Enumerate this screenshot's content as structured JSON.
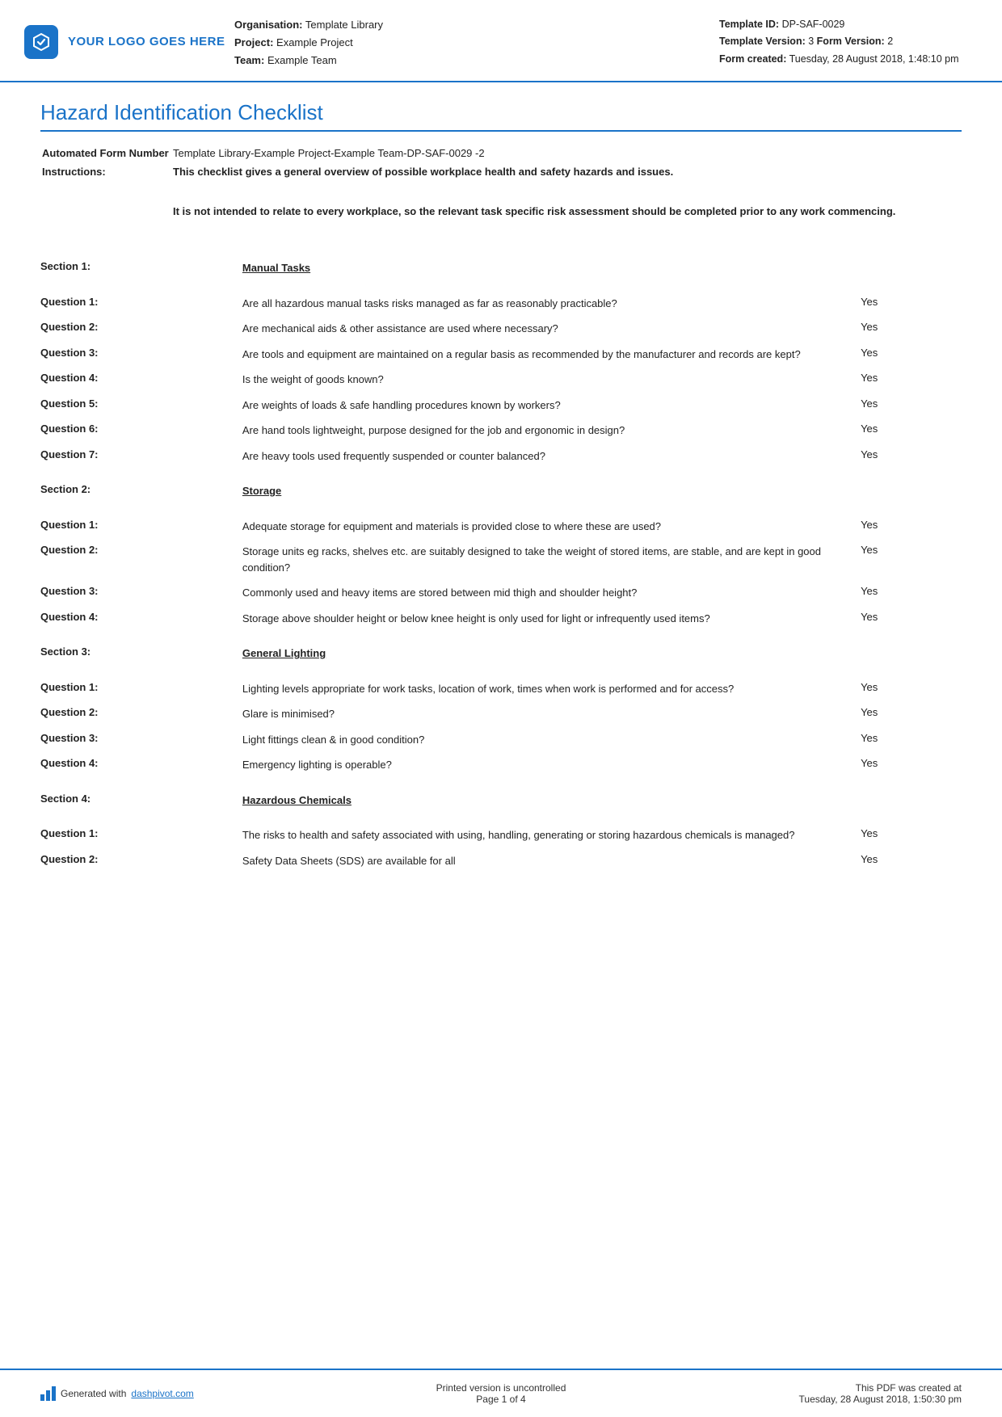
{
  "header": {
    "logo_text": "YOUR LOGO GOES HERE",
    "org_label": "Organisation:",
    "org_value": "Template Library",
    "project_label": "Project:",
    "project_value": "Example Project",
    "team_label": "Team:",
    "team_value": "Example Team",
    "template_id_label": "Template ID:",
    "template_id_value": "DP-SAF-0029",
    "template_version_label": "Template Version:",
    "template_version_value": "3",
    "form_version_label": "Form Version:",
    "form_version_value": "2",
    "form_created_label": "Form created:",
    "form_created_value": "Tuesday, 28 August 2018, 1:48:10 pm"
  },
  "page_title": "Hazard Identification Checklist",
  "meta": {
    "form_number_label": "Automated Form Number",
    "form_number_value": "Template Library-Example Project-Example Team-DP-SAF-0029  -2",
    "instructions_label": "Instructions:",
    "instructions_bold": "This checklist gives a general overview of possible workplace health and safety hazards and issues.",
    "instructions_text": "It is not intended to relate to every workplace, so the relevant task specific risk assessment should be completed prior to any work commencing."
  },
  "sections": [
    {
      "label": "Section 1:",
      "title": "Manual Tasks",
      "questions": [
        {
          "label": "Question 1:",
          "text": "Are all hazardous manual tasks risks managed as far as reasonably practicable?",
          "answer": "Yes"
        },
        {
          "label": "Question 2:",
          "text": "Are mechanical aids & other assistance are used where necessary?",
          "answer": "Yes"
        },
        {
          "label": "Question 3:",
          "text": "Are tools and equipment are maintained on a regular basis as recommended by the manufacturer and records are kept?",
          "answer": "Yes"
        },
        {
          "label": "Question 4:",
          "text": "Is the weight of goods known?",
          "answer": "Yes"
        },
        {
          "label": "Question 5:",
          "text": "Are weights of loads & safe handling procedures known by workers?",
          "answer": "Yes"
        },
        {
          "label": "Question 6:",
          "text": "Are hand tools lightweight, purpose designed for the job and ergonomic in design?",
          "answer": "Yes"
        },
        {
          "label": "Question 7:",
          "text": "Are heavy tools used frequently suspended or counter balanced?",
          "answer": "Yes"
        }
      ]
    },
    {
      "label": "Section 2:",
      "title": "Storage",
      "questions": [
        {
          "label": "Question 1:",
          "text": "Adequate storage for equipment and materials is provided close to where these are used?",
          "answer": "Yes"
        },
        {
          "label": "Question 2:",
          "text": "Storage units eg racks, shelves etc. are suitably designed to take the weight of stored items, are stable, and are kept in good condition?",
          "answer": "Yes"
        },
        {
          "label": "Question 3:",
          "text": "Commonly used and heavy items are stored between mid thigh and shoulder height?",
          "answer": "Yes"
        },
        {
          "label": "Question 4:",
          "text": "Storage above shoulder height or below knee height is only used for light or infrequently used items?",
          "answer": "Yes"
        }
      ]
    },
    {
      "label": "Section 3:",
      "title": "General Lighting",
      "questions": [
        {
          "label": "Question 1:",
          "text": "Lighting levels appropriate for work tasks, location of work, times when work is performed and for access?",
          "answer": "Yes"
        },
        {
          "label": "Question 2:",
          "text": "Glare is minimised?",
          "answer": "Yes"
        },
        {
          "label": "Question 3:",
          "text": "Light fittings clean & in good condition?",
          "answer": "Yes"
        },
        {
          "label": "Question 4:",
          "text": "Emergency lighting is operable?",
          "answer": "Yes"
        }
      ]
    },
    {
      "label": "Section 4:",
      "title": "Hazardous Chemicals",
      "questions": [
        {
          "label": "Question 1:",
          "text": "The risks to health and safety associated with using, handling, generating or storing hazardous chemicals is managed?",
          "answer": "Yes"
        },
        {
          "label": "Question 2:",
          "text": "Safety Data Sheets (SDS) are available for all",
          "answer": "Yes"
        }
      ]
    }
  ],
  "footer": {
    "generated_text": "Generated with ",
    "generated_link": "dashpivot.com",
    "center_line1": "Printed version is uncontrolled",
    "center_line2": "Page 1 of 4",
    "right_line1": "This PDF was created at",
    "right_line2": "Tuesday, 28 August 2018, 1:50:30 pm"
  }
}
